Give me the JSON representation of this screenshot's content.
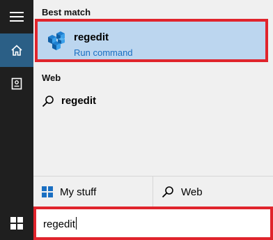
{
  "rail": {
    "menu_icon": "hamburger-icon",
    "home_icon": "home-icon",
    "notebook_icon": "notebook-icon",
    "start_icon": "windows-logo-icon",
    "active_color": "#2b5f86"
  },
  "results": {
    "best_match_label": "Best match",
    "best_match": {
      "title": "regedit",
      "subtitle": "Run command",
      "icon": "registry-editor-icon"
    },
    "web_label": "Web",
    "web_items": [
      {
        "label": "regedit",
        "icon": "search-icon"
      }
    ]
  },
  "scopes": {
    "my_stuff": {
      "label": "My stuff",
      "icon": "windows-logo-icon"
    },
    "web": {
      "label": "Web",
      "icon": "search-icon"
    }
  },
  "search": {
    "value": "regedit"
  },
  "colors": {
    "highlight": "#bcd6ef",
    "accent_text": "#1a6fc2",
    "annotation_border": "#e0242c"
  }
}
